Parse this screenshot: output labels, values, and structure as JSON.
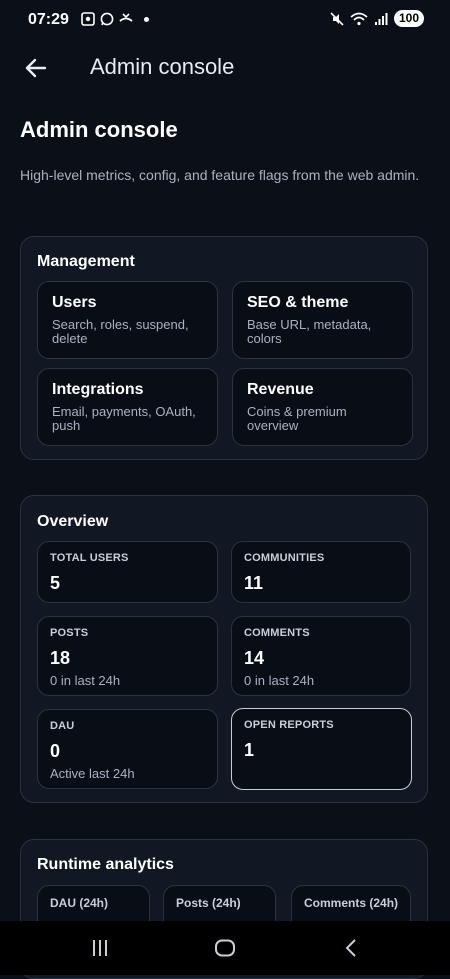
{
  "status_bar": {
    "time": "07:29",
    "battery": "100"
  },
  "app_bar": {
    "title": "Admin console"
  },
  "page": {
    "title": "Admin console",
    "description": "High-level metrics, config, and feature flags from the web admin."
  },
  "management": {
    "title": "Management",
    "tiles": [
      {
        "title": "Users",
        "subtitle": "Search, roles, suspend, delete"
      },
      {
        "title": "SEO & theme",
        "subtitle": "Base URL, metadata, colors"
      },
      {
        "title": "Integrations",
        "subtitle": "Email, payments, OAuth, push"
      },
      {
        "title": "Revenue",
        "subtitle": "Coins & premium overview"
      }
    ]
  },
  "overview": {
    "title": "Overview",
    "stats": [
      {
        "label": "TOTAL USERS",
        "value": "5",
        "sub": ""
      },
      {
        "label": "COMMUNITIES",
        "value": "11",
        "sub": ""
      },
      {
        "label": "POSTS",
        "value": "18",
        "sub": "0 in last 24h"
      },
      {
        "label": "COMMENTS",
        "value": "14",
        "sub": "0 in last 24h"
      },
      {
        "label": "DAU",
        "value": "0",
        "sub": "Active last 24h"
      },
      {
        "label": "OPEN REPORTS",
        "value": "1",
        "sub": ""
      }
    ]
  },
  "runtime": {
    "title": "Runtime analytics",
    "stats": [
      {
        "label": "DAU (24h)"
      },
      {
        "label": "Posts (24h)"
      },
      {
        "label": "Comments (24h)"
      }
    ]
  },
  "colors": {
    "background": "#0b0f17",
    "card": "#111823",
    "tile": "#090d16",
    "border": "#2a3342"
  }
}
